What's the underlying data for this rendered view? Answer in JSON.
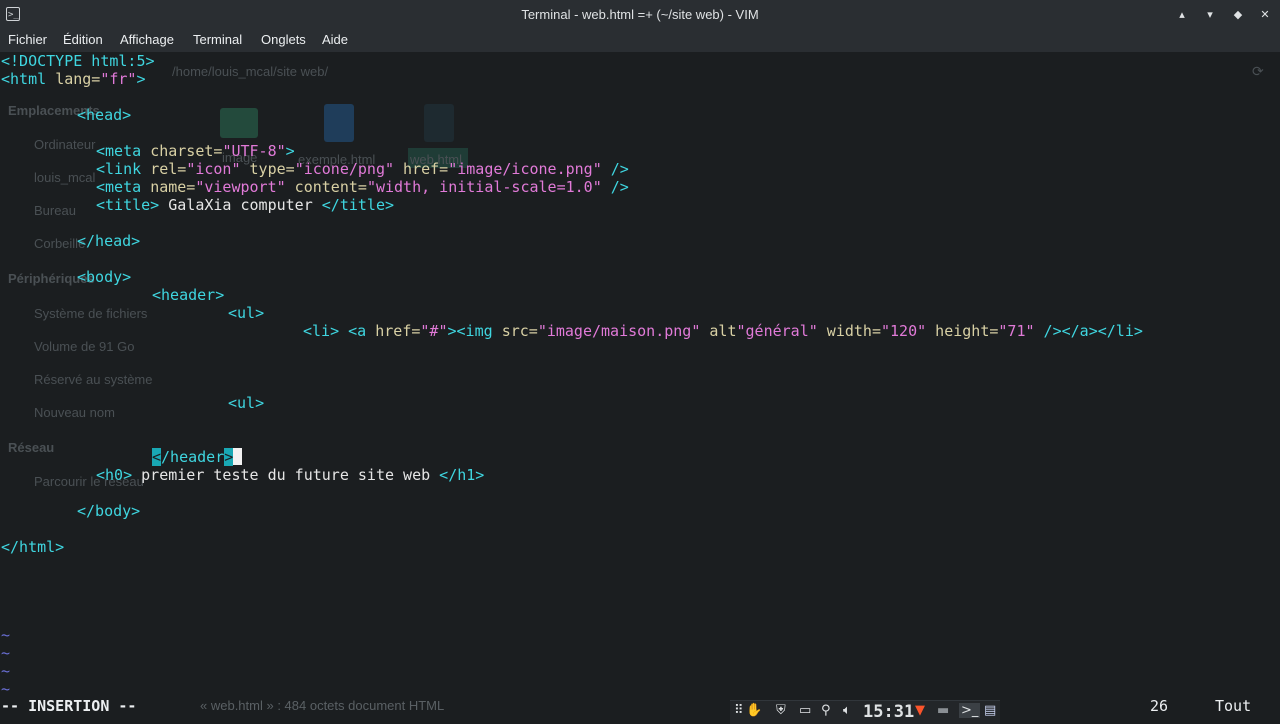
{
  "window": {
    "title": "Terminal - web.html =+ (~/site web) - VIM",
    "app_icon": "terminal-icon",
    "buttons": [
      {
        "name": "keep-above-button",
        "glyph": "▴"
      },
      {
        "name": "minimize-button",
        "glyph": "▾"
      },
      {
        "name": "maximize-button",
        "glyph": "◆"
      },
      {
        "name": "close-button",
        "glyph": "✕"
      }
    ]
  },
  "menu": [
    "Fichier",
    "Édition",
    "Affichage",
    "Terminal",
    "Onglets",
    "Aide"
  ],
  "background_ghost": {
    "path": "/home/louis_mcal/site web/",
    "sections": [
      "Emplacements",
      "Périphériques",
      "Réseau"
    ],
    "items": [
      "Ordinateur",
      "louis_mcal",
      "Bureau",
      "Corbeille",
      "Système de fichiers",
      "Volume de 91 Go",
      "Réservé au système",
      "Nouveau nom",
      "Parcourir le réseau"
    ],
    "files": [
      "image",
      "exemple.html",
      "web.html"
    ],
    "status": "« web.html » : 484 octets document HTML"
  },
  "editor": {
    "lines": {
      "l1": "<!DOCTYPE html:5>",
      "l2a": "<html ",
      "l2b": "lang=",
      "l2c": "\"fr\"",
      "l2d": ">",
      "l4": "<head>",
      "l6a": "<meta ",
      "l6b": "charset=",
      "l6c": "\"UTF-8\"",
      "l6d": ">",
      "l7a": "<link ",
      "l7b": "rel=",
      "l7c": "\"icon\"",
      "l7d": " type=",
      "l7e": "\"icone/png\"",
      "l7f": " href=",
      "l7g": "\"image/icone.png\"",
      "l7h": " />",
      "l8a": "<meta ",
      "l8b": "name=",
      "l8c": "\"viewport\"",
      "l8d": " content=",
      "l8e": "\"width, initial-scale=1.0\"",
      "l8f": " />",
      "l9a": "<title>",
      "l9b": " GalaXia computer ",
      "l9c": "</title>",
      "l11": "</head>",
      "l13": "<body>",
      "l14": "<header>",
      "l15": "<ul>",
      "l16a": "<li>",
      "l16b": " ",
      "l16c": "<a ",
      "l16d": "href=",
      "l16e": "\"#\"",
      "l16f": "><img ",
      "l16g": "src=",
      "l16h": "\"image/maison.png\"",
      "l16i": " alt",
      "l16j": "\"général\"",
      "l16k": " width=",
      "l16l": "\"120\"",
      "l16m": " height=",
      "l16n": "\"71\"",
      "l16o": " /></a></li>",
      "l20": "<ul>",
      "l23a": "<",
      "l23b": "/header",
      "l23c": ">",
      "l24a": "<h0>",
      "l24b": " premier teste du future site web ",
      "l24c": "</h1>",
      "l26": "</body>",
      "l28": "</html>"
    },
    "tilde": "~",
    "mode": "-- INSERTION --",
    "ruler_position": "26",
    "ruler_scroll": "Tout"
  },
  "tray": {
    "clock": "15:31",
    "icons": [
      "drag-handle-icon",
      "hand-icon",
      "shield-icon",
      "window-icon",
      "paperclip-icon",
      "volume-icon",
      "brave-icon",
      "folder-icon",
      "terminal-icon",
      "document-icon"
    ]
  }
}
